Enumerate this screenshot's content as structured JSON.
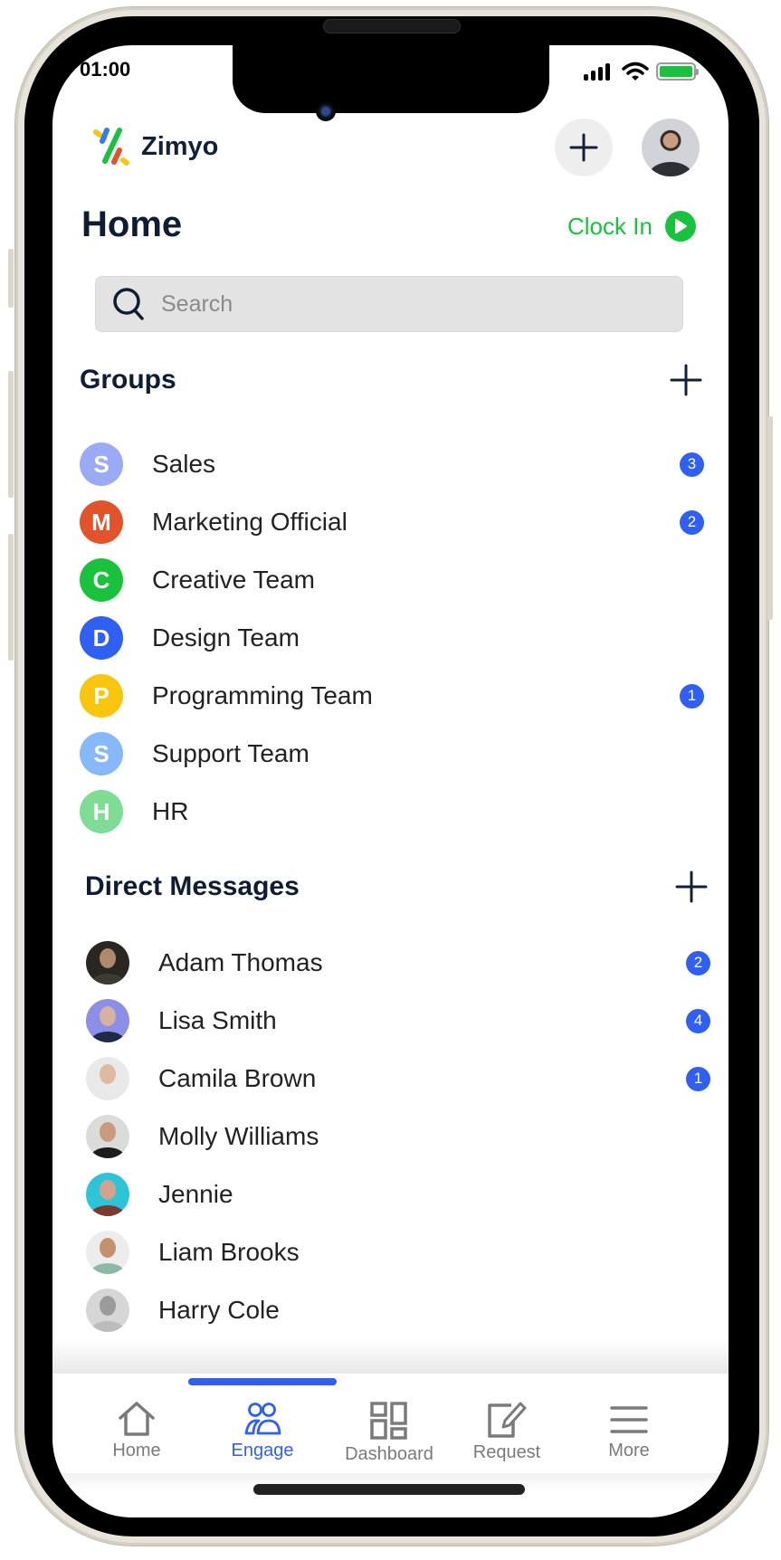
{
  "status_bar": {
    "time": "01:00",
    "icons": [
      "signal-icon",
      "wifi-icon",
      "battery-icon"
    ]
  },
  "header": {
    "brand": "Zimyo",
    "add_button_icon": "plus-icon",
    "avatar": "profile-avatar"
  },
  "page": {
    "title": "Home",
    "clock_in_label": "Clock In",
    "clock_in_icon": "play-icon"
  },
  "search": {
    "placeholder": "Search",
    "value": ""
  },
  "groups": {
    "title": "Groups",
    "items": [
      {
        "initial": "S",
        "name": "Sales",
        "color": "#9aaaf7",
        "badge": "3"
      },
      {
        "initial": "M",
        "name": "Marketing Official",
        "color": "#e2522b",
        "badge": "2"
      },
      {
        "initial": "C",
        "name": "Creative Team",
        "color": "#19c23c",
        "badge": null
      },
      {
        "initial": "D",
        "name": "Design Team",
        "color": "#2f5ff3",
        "badge": null
      },
      {
        "initial": "P",
        "name": "Programming Team",
        "color": "#f8c60d",
        "badge": "1"
      },
      {
        "initial": "S",
        "name": "Support Team",
        "color": "#86b8fb",
        "badge": null
      },
      {
        "initial": "H",
        "name": "HR",
        "color": "#7fdc95",
        "badge": null
      }
    ]
  },
  "direct_messages": {
    "title": "Direct Messages",
    "items": [
      {
        "name": "Adam Thomas",
        "badge": "2",
        "bg": "#2a2723",
        "face": "#b08870",
        "body": "#3e3b32"
      },
      {
        "name": "Lisa Smith",
        "badge": "4",
        "bg": "#8c8fe8",
        "face": "#d5b2a0",
        "body": "#1f2a45"
      },
      {
        "name": "Camila Brown",
        "badge": "1",
        "bg": "#e9e9e9",
        "face": "#dfb9a2",
        "body": "#e8e8e8"
      },
      {
        "name": "Molly Williams",
        "badge": null,
        "bg": "#d9dcd9",
        "face": "#c99a7d",
        "body": "#1d1d1d"
      },
      {
        "name": "Jennie",
        "badge": null,
        "bg": "#2ec4d8",
        "face": "#d4a28a",
        "body": "#7a3a2e"
      },
      {
        "name": "Liam Brooks",
        "badge": null,
        "bg": "#ececec",
        "face": "#c4916f",
        "body": "#8cb9a5"
      },
      {
        "name": "Harry Cole",
        "badge": null,
        "bg": "#d6d6d6",
        "face": "#9b9b9b",
        "body": "#bcbcbc"
      }
    ]
  },
  "tabbar": {
    "active": "Engage",
    "tabs": [
      {
        "label": "Home",
        "icon": "home-icon"
      },
      {
        "label": "Engage",
        "icon": "users-icon"
      },
      {
        "label": "Dashboard",
        "icon": "dashboard-icon"
      },
      {
        "label": "Request",
        "icon": "edit-icon"
      },
      {
        "label": "More",
        "icon": "menu-icon"
      }
    ]
  },
  "colors": {
    "accent": "#2f5ff3",
    "clock_in": "#19c23c",
    "title": "#0f1d33"
  }
}
